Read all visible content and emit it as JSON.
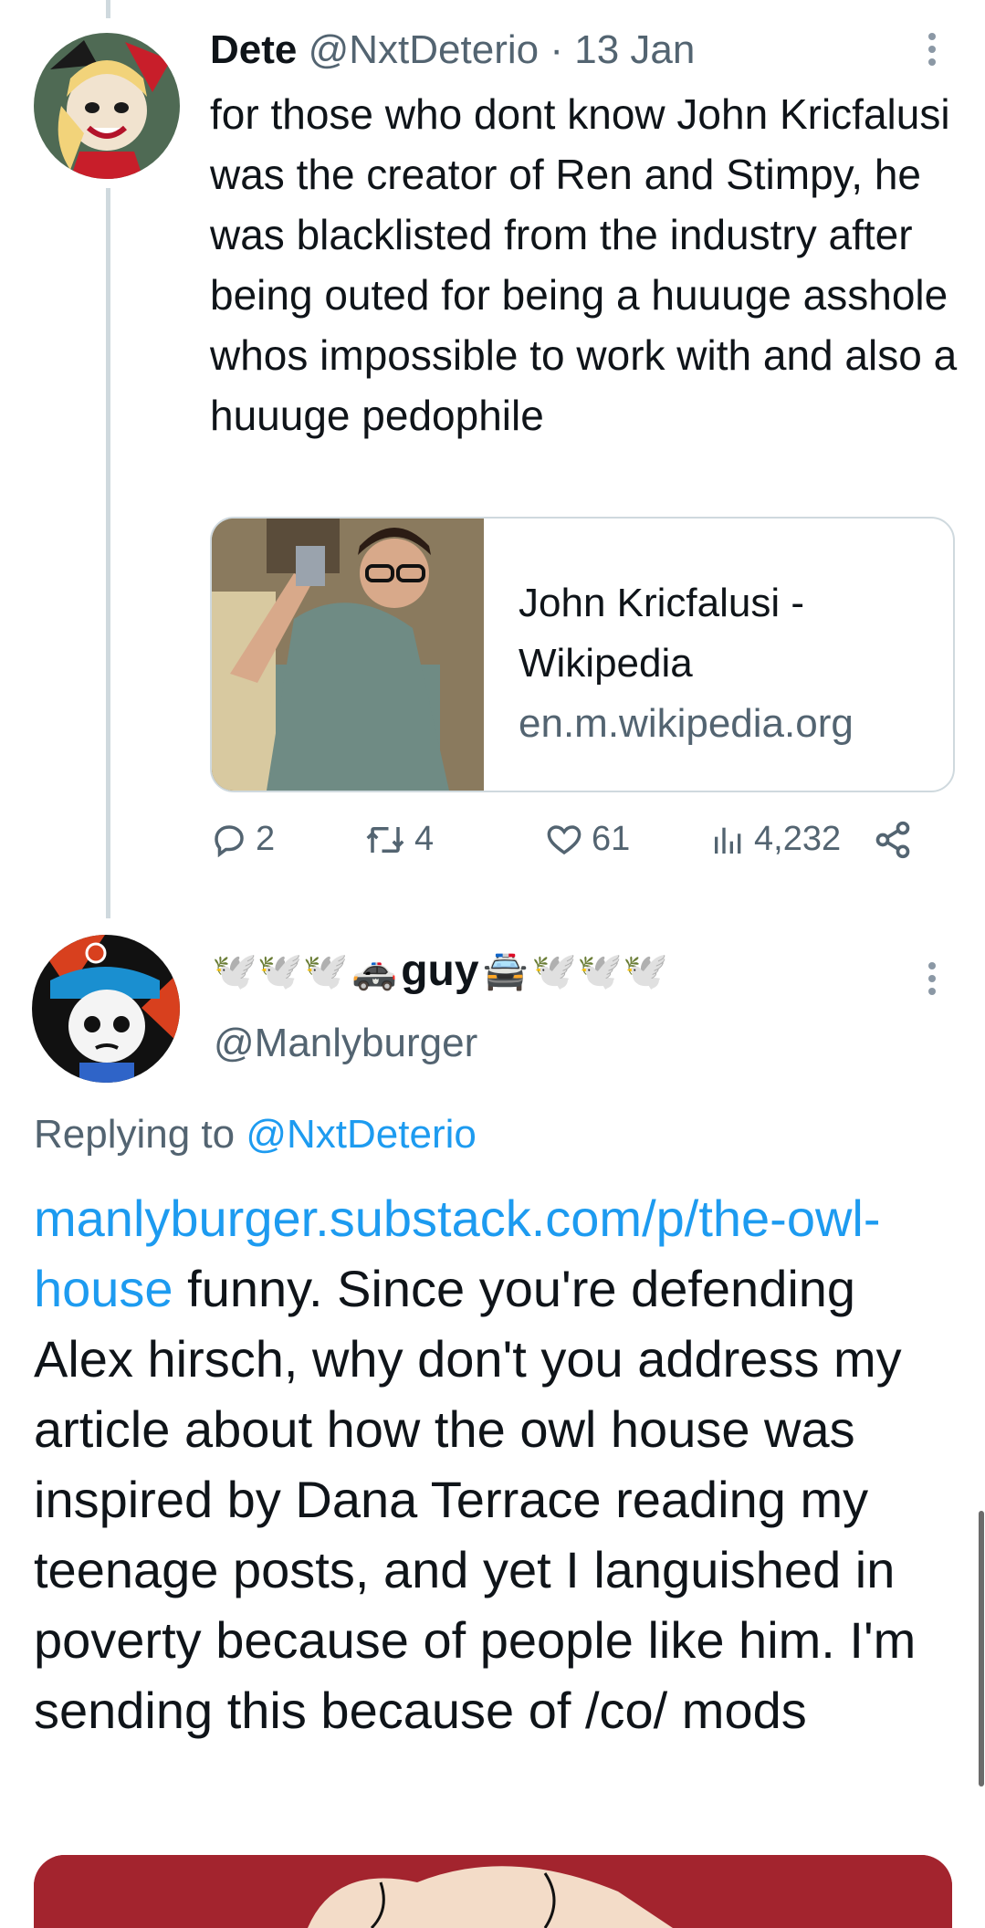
{
  "tweet1": {
    "display_name": "Dete",
    "handle": "@NxtDeterio",
    "separator": " · ",
    "date": "13 Jan",
    "body": "for those who dont know John Kricfalusi was the creator of Ren and Stimpy, he was blacklisted from the industry after being outed for being a huuuge asshole whos impossible to work with and also a huuuge pedophile",
    "link_card": {
      "title": "John Kricfalusi - Wikipedia",
      "domain": "en.m.wikipedia.org"
    },
    "stats": {
      "replies": "2",
      "reposts": "4",
      "likes": "61",
      "views": "4,232"
    }
  },
  "tweet2": {
    "display_name_text": "guy",
    "handle": "@Manlyburger",
    "replying_prefix": "Replying to ",
    "replying_to": "@NxtDeterio",
    "link_text": "manlyburger.substack.com/p/the-owl-house",
    "body_text": " funny. Since you're defending Alex hirsch, why don't you address my article about how the owl house was inspired by Dana Terrace reading my teenage posts, and yet I languished in poverty because of people like him. I'm sending this because of /co/ mods"
  },
  "icons": {
    "reply": "speech-bubble-icon",
    "repost": "repost-arrows-icon",
    "like": "heart-icon",
    "views": "bar-chart-icon",
    "share": "share-nodes-icon",
    "more": "vertical-dots-icon"
  },
  "colors": {
    "link": "#1d9bf0",
    "secondary_text": "#536471",
    "thread_line": "#cfd9de"
  }
}
